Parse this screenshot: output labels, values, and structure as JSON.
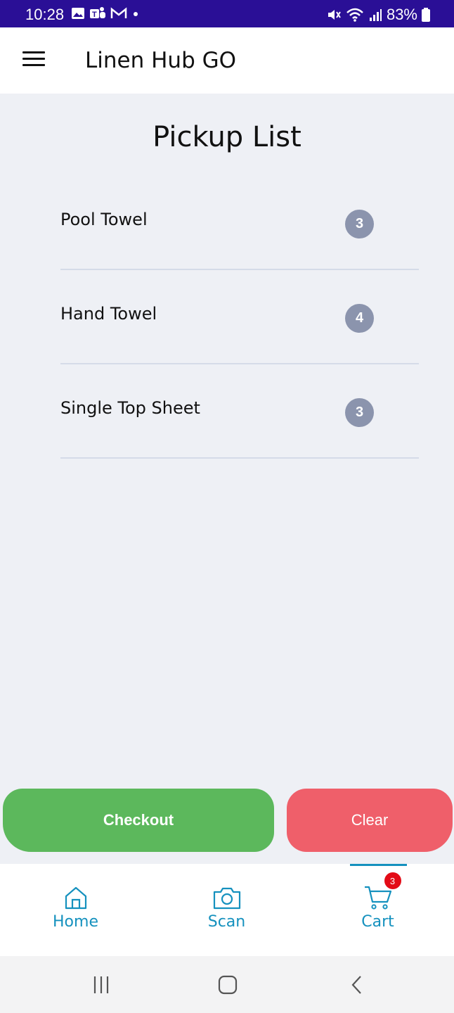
{
  "status_bar": {
    "time": "10:28",
    "battery": "83%",
    "icons_left": [
      "gallery-icon",
      "teams-icon",
      "gmail-icon",
      "dot-icon"
    ],
    "icons_right": [
      "mute-icon",
      "wifi-icon",
      "signal-icon",
      "battery-icon"
    ],
    "background": "#2a0f96"
  },
  "app_bar": {
    "title": "Linen Hub GO"
  },
  "page": {
    "title": "Pickup List"
  },
  "pickup_items": [
    {
      "label": "Pool Towel",
      "count": "3"
    },
    {
      "label": "Hand Towel",
      "count": "4"
    },
    {
      "label": "Single Top Sheet",
      "count": "3"
    }
  ],
  "actions": {
    "checkout_label": "Checkout",
    "clear_label": "Clear",
    "checkout_color": "#5cb85c",
    "clear_color": "#ef5f6a"
  },
  "bottom_nav": {
    "items": [
      {
        "label": "Home",
        "icon": "home-icon"
      },
      {
        "label": "Scan",
        "icon": "camera-icon"
      },
      {
        "label": "Cart",
        "icon": "cart-icon",
        "badge": "3",
        "active": true
      }
    ],
    "accent": "#1591be"
  }
}
